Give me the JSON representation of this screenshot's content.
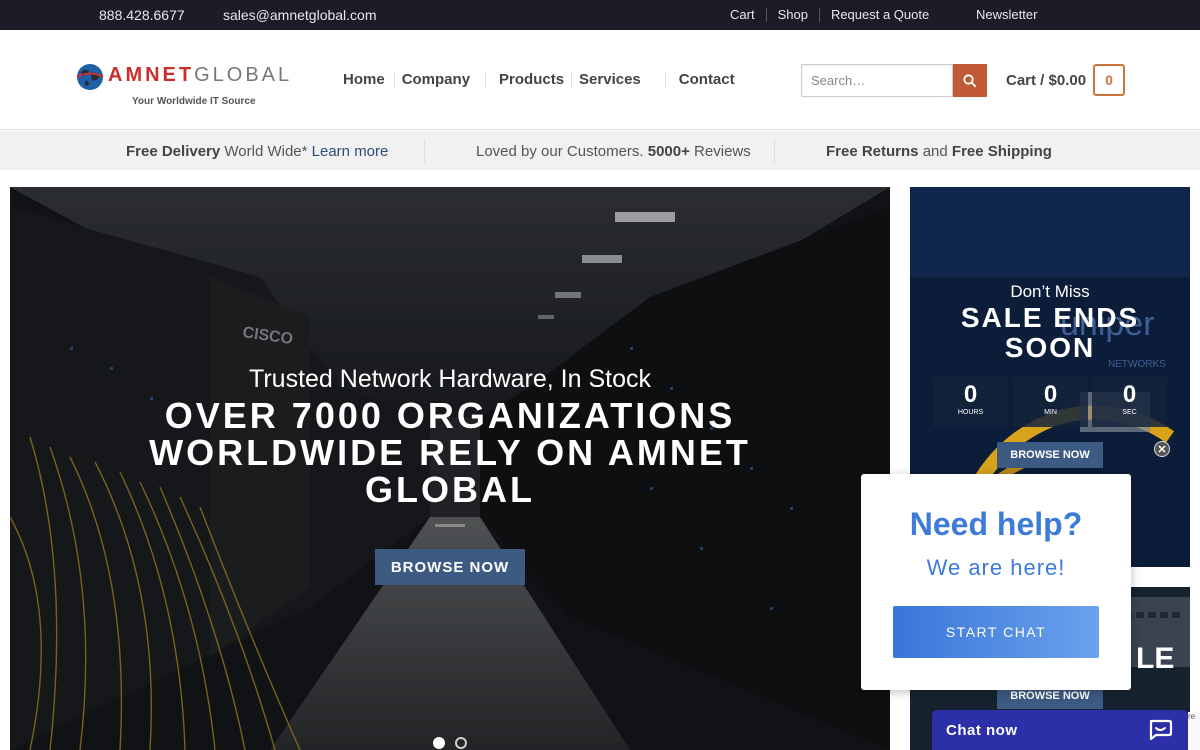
{
  "topbar": {
    "phone": "888.428.6677",
    "email": "sales@amnetglobal.com",
    "links": [
      "Cart",
      "Shop",
      "Request a Quote"
    ],
    "newsletter": "Newsletter"
  },
  "logo": {
    "amnet": "AMNET",
    "global": "GLOBAL",
    "tagline": "Your Worldwide IT Source"
  },
  "nav": {
    "home": "Home",
    "company": "Company",
    "products": "Products",
    "services": "Services",
    "contact": "Contact"
  },
  "search": {
    "placeholder": "Search…"
  },
  "cart": {
    "label": "Cart / $0.00",
    "count": "0"
  },
  "promo": {
    "delivery_bold": "Free Delivery",
    "delivery_rest": " World Wide* ",
    "learn_more": "Learn more",
    "loved": "Loved by our Customers. ",
    "reviews_count": "5000+",
    "reviews": " Reviews",
    "free_returns": "Free Returns",
    "and": " and ",
    "free_shipping": "Free Shipping"
  },
  "hero": {
    "subtitle": "Trusted Network Hardware, In Stock",
    "headline_1": "OVER 7000 ORGANIZATIONS",
    "headline_2": "WORLDWIDE RELY ON AMNET",
    "headline_3": "GLOBAL",
    "button": "BROWSE NOW",
    "rack_brand": "CISCO",
    "active_slide": 1,
    "slide_count": 2
  },
  "sale": {
    "dont_miss": "Don’t Miss",
    "title_1": "SALE ENDS",
    "title_2": "SOON",
    "countdown": [
      {
        "value": "0",
        "unit": "HOURS"
      },
      {
        "value": "0",
        "unit": "MIN"
      },
      {
        "value": "0",
        "unit": "SEC"
      }
    ],
    "button": "BROWSE NOW",
    "bg_brand": "uniper",
    "bg_brand_sub": "NETWORKS"
  },
  "panel2": {
    "big_text": "LE",
    "button": "BROWSE NOW"
  },
  "chat_popup": {
    "close": "✕",
    "title": "Need help?",
    "subtitle": "We are here!",
    "button": "START CHAT"
  },
  "chat_bar": {
    "label": "Chat now"
  },
  "recaptcha": "re"
}
